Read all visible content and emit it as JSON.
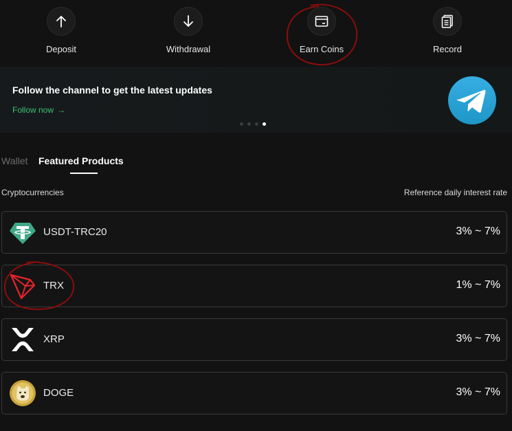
{
  "actions": [
    {
      "label": "Deposit",
      "icon": "arrow-up-icon"
    },
    {
      "label": "Withdrawal",
      "icon": "arrow-down-icon"
    },
    {
      "label": "Earn Coins",
      "icon": "wallet-card-icon"
    },
    {
      "label": "Record",
      "icon": "document-icon"
    }
  ],
  "banner": {
    "title": "Follow the channel to get the latest updates",
    "link_label": "Follow now",
    "link_arrow": "→",
    "logo": "telegram-icon",
    "carousel_active_index": 3,
    "carousel_count": 4
  },
  "tabs": [
    {
      "label": "Wallet",
      "active": false
    },
    {
      "label": "Featured Products",
      "active": true
    }
  ],
  "columns": {
    "left": "Cryptocurrencies",
    "right": "Reference daily interest rate"
  },
  "products": [
    {
      "name": "USDT-TRC20",
      "rate": "3% ~ 7%",
      "icon": "tether-icon"
    },
    {
      "name": "TRX",
      "rate": "1% ~ 7%",
      "icon": "tron-icon"
    },
    {
      "name": "XRP",
      "rate": "3% ~ 7%",
      "icon": "xrp-icon"
    },
    {
      "name": "DOGE",
      "rate": "3% ~ 7%",
      "icon": "dogecoin-icon"
    }
  ],
  "colors": {
    "background": "#121212",
    "accent_green": "#38c172",
    "annotation_red": "#8b0d0d",
    "telegram_blue": "#2ea6da"
  }
}
